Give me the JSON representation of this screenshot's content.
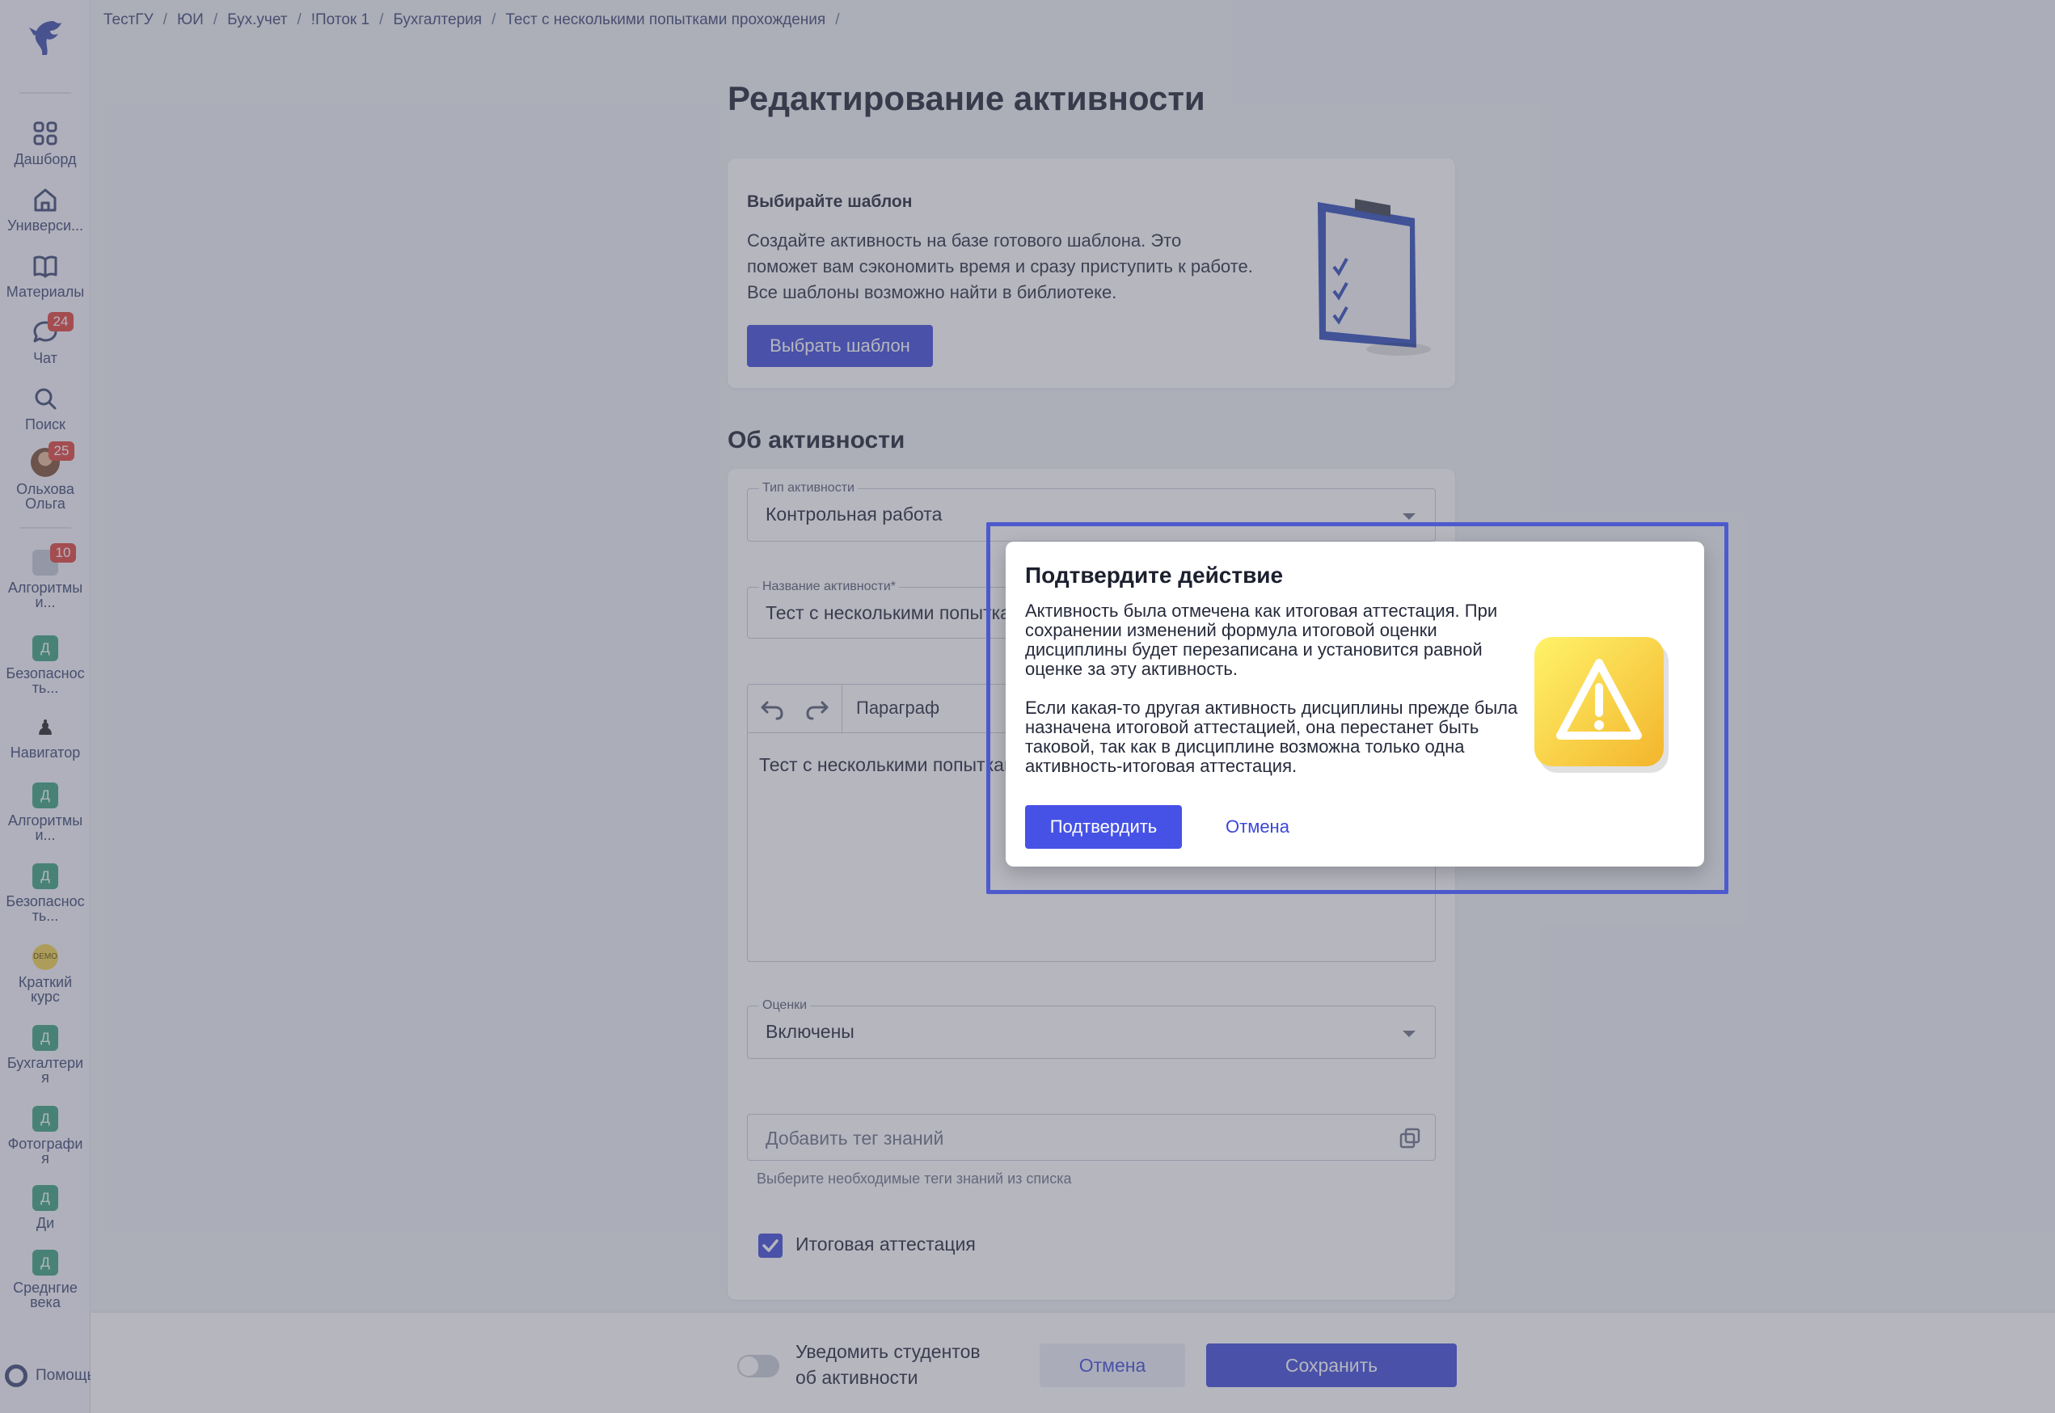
{
  "breadcrumb": [
    "ТестГУ",
    "ЮИ",
    "Бух.учет",
    "!Поток 1",
    "Бухгалтерия",
    "Тест с несколькими попытками прохождения"
  ],
  "breadcrumb_sep": "/",
  "sidebar": {
    "items": [
      {
        "label": "Дашборд",
        "icon": "grid-icon"
      },
      {
        "label": "Универси...",
        "icon": "home-icon"
      },
      {
        "label": "Материалы",
        "icon": "book-icon"
      },
      {
        "label": "Чат",
        "icon": "chat-icon",
        "badge": "24"
      },
      {
        "label": "Поиск",
        "icon": "search-icon"
      },
      {
        "label": "Ольхова Ольга",
        "icon": "avatar",
        "badge": "25"
      }
    ],
    "courses": [
      {
        "label": "Алгоритмы и...",
        "tile": "",
        "badge": "10"
      },
      {
        "label": "Безопаснос ть...",
        "tile": "Д"
      },
      {
        "label": "Навигатор",
        "tile": "♟"
      },
      {
        "label": "Алгоритмы и...",
        "tile": "Д"
      },
      {
        "label": "Безопаснос ть...",
        "tile": "Д"
      },
      {
        "label": "Краткий курс",
        "tile": "DEMO"
      },
      {
        "label": "Бухгалтери я",
        "tile": "Д"
      },
      {
        "label": "Фотографи я",
        "tile": "Д"
      },
      {
        "label": "Ди",
        "tile": "Д"
      },
      {
        "label": "Среднгие века",
        "tile": "Д"
      }
    ],
    "help": "Помощь"
  },
  "page": {
    "title": "Редактирование активности",
    "template_card": {
      "title": "Выбирайте шаблон",
      "text": "Создайте активность на базе готового шаблона. Это поможет вам сэкономить время и сразу приступить к работе. Все шаблоны возможно найти в библиотеке.",
      "button": "Выбрать шаблон"
    },
    "section_title": "Об активности",
    "form": {
      "activity_type_label": "Тип активности",
      "activity_type_value": "Контрольная работа",
      "name_label": "Название активности*",
      "name_value": "Тест с несколькими попытками прохождения",
      "editor_paragraph": "Параграф",
      "editor_text": "Тест с несколькими попытками прохождения",
      "grades_label": "Оценки",
      "grades_value": "Включены",
      "tag_placeholder": "Добавить тег знаний",
      "tag_hint": "Выберите необходимые теги знаний из списка",
      "final_attestation_label": "Итоговая аттестация",
      "final_attestation_checked": true
    }
  },
  "bottom_bar": {
    "notify_label": "Уведомить студентов об активности",
    "cancel": "Отмена",
    "save": "Сохранить"
  },
  "modal": {
    "title": "Подтвердите действие",
    "paragraph1": "Активность была отмечена как итоговая аттестация. При сохранении изменений формула итоговой оценки дисциплины будет перезаписана и установится равной оценке за эту активность.",
    "paragraph2": "Если какая-то другая активность дисциплины прежде была назначена итоговой аттестацией, она перестанет быть таковой, так как в дисциплине возможна только одна активность-итоговая аттестация.",
    "confirm": "Подтвердить",
    "cancel": "Отмена",
    "icon": "warning-icon"
  },
  "colors": {
    "accent": "#3b48d8",
    "badge": "#e0403a",
    "course_tile": "#3aa17e",
    "highlight": "#4d5acd"
  }
}
